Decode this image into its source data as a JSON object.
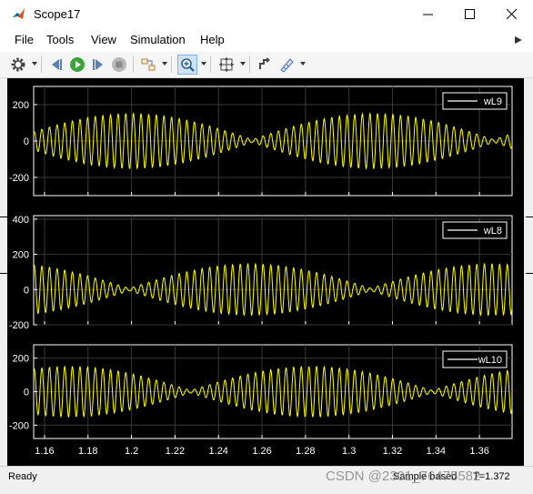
{
  "window": {
    "title": "Scope17"
  },
  "menu": {
    "items": [
      "File",
      "Tools",
      "View",
      "Simulation",
      "Help"
    ]
  },
  "toolbar": {
    "buttons": [
      "gear-icon",
      "step-back-icon",
      "run-icon",
      "step-forward-icon",
      "stop-icon",
      "signal-select-icon",
      "zoom-icon",
      "fit-icon",
      "highlight-icon",
      "measure-icon"
    ]
  },
  "status": {
    "left": "Ready",
    "sample": "Sample based",
    "time": "T=1.372"
  },
  "watermark": "CSDN @2301_76475582",
  "colors": {
    "plot_bg": "#000000",
    "axes_bg": "#000000",
    "axes_fg": "#ffffff",
    "grid": "#3a3a3a",
    "trace": "#ffff00"
  },
  "chart_data": [
    {
      "type": "line",
      "series": [
        {
          "name": "wL9",
          "color": "#ffff00"
        }
      ],
      "xlim": [
        1.155,
        1.375
      ],
      "ylim": [
        -300,
        300
      ],
      "yticks": [
        -200,
        0,
        200
      ],
      "yticklabels": [
        "-200",
        "0",
        "200"
      ],
      "xticks": [
        1.16,
        1.18,
        1.2,
        1.22,
        1.24,
        1.26,
        1.28,
        1.3,
        1.32,
        1.34,
        1.36
      ],
      "amplitude": 155,
      "carrier_hz": 285,
      "envelope_hz": 9,
      "envelope_phase": 0.3,
      "grid": true,
      "legend": "top-right"
    },
    {
      "type": "line",
      "series": [
        {
          "name": "wL8",
          "color": "#ffff00"
        }
      ],
      "xlim": [
        1.155,
        1.375
      ],
      "ylim": [
        -200,
        420
      ],
      "yticks": [
        -200,
        0,
        200,
        400
      ],
      "yticklabels": [
        "-200",
        "0",
        "200",
        "400"
      ],
      "xticks": [
        1.16,
        1.18,
        1.2,
        1.22,
        1.24,
        1.26,
        1.28,
        1.3,
        1.32,
        1.34,
        1.36
      ],
      "amplitude": 150,
      "carrier_hz": 285,
      "envelope_hz": 9,
      "envelope_phase": 1.9,
      "grid": true,
      "legend": "top-right"
    },
    {
      "type": "line",
      "series": [
        {
          "name": "wL10",
          "color": "#ffff00"
        }
      ],
      "xlim": [
        1.155,
        1.375
      ],
      "ylim": [
        -280,
        280
      ],
      "yticks": [
        -200,
        0,
        200
      ],
      "yticklabels": [
        "-200",
        "0",
        "200"
      ],
      "xticks": [
        1.16,
        1.18,
        1.2,
        1.22,
        1.24,
        1.26,
        1.28,
        1.3,
        1.32,
        1.34,
        1.36
      ],
      "xticklabels": [
        "1.16",
        "1.18",
        "1.2",
        "1.22",
        "1.24",
        "1.26",
        "1.28",
        "1.3",
        "1.32",
        "1.34",
        "1.36"
      ],
      "amplitude": 155,
      "carrier_hz": 285,
      "envelope_hz": 9,
      "envelope_phase": 1.1,
      "grid": true,
      "legend": "top-right"
    }
  ]
}
